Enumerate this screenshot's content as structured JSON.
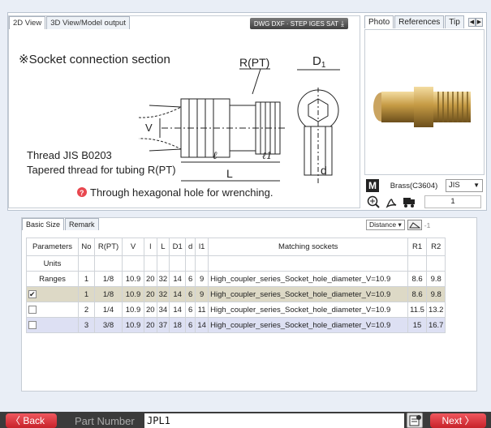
{
  "drawing": {
    "tabs": [
      "2D View",
      "3D View/Model output"
    ],
    "download_label": "DWG DXF · STEP IGES SAT",
    "section_title": "※Socket connection section",
    "label_rpt": "R(PT)",
    "label_d1": "D",
    "label_d1_sub": "1",
    "label_v": "V",
    "label_l": "ℓ",
    "label_l1": "ℓ1",
    "label_L": "L",
    "label_d": "d",
    "thread_line1": "Thread JIS B0203",
    "thread_line2": "Tapered thread for tubing R(PT)",
    "note": "Through hexagonal hole for wrenching."
  },
  "photo": {
    "tabs": [
      "Photo",
      "References",
      "Tip"
    ],
    "material_icon": "M",
    "material": "Brass(C3604)",
    "standard": "JIS",
    "quantity": "1"
  },
  "table": {
    "tabs": [
      "Basic Size",
      "Remark"
    ],
    "distance_label": "Distance",
    "distance_value": "-1",
    "headers": [
      "Parameters",
      "No",
      "R(PT)",
      "V",
      "l",
      "L",
      "D1",
      "d",
      "l1",
      "Matching sockets",
      "R1",
      "R2"
    ],
    "units_label": "Units",
    "ranges": [
      "Ranges",
      "1",
      "1/8",
      "10.9",
      "20",
      "32",
      "14",
      "6",
      "9",
      "High_coupler_series_Socket_hole_diameter_V=10.9",
      "8.6",
      "9.8"
    ],
    "rows": [
      {
        "checked": "✔",
        "cells": [
          "1",
          "1/8",
          "10.9",
          "20",
          "32",
          "14",
          "6",
          "9",
          "High_coupler_series_Socket_hole_diameter_V=10.9",
          "8.6",
          "9.8"
        ]
      },
      {
        "checked": "",
        "cells": [
          "2",
          "1/4",
          "10.9",
          "20",
          "34",
          "14",
          "6",
          "11",
          "High_coupler_series_Socket_hole_diameter_V=10.9",
          "11.5",
          "13.2"
        ]
      },
      {
        "checked": "",
        "cells": [
          "3",
          "3/8",
          "10.9",
          "20",
          "37",
          "18",
          "6",
          "14",
          "High_coupler_series_Socket_hole_diameter_V=10.9",
          "15",
          "16.7"
        ]
      }
    ]
  },
  "nav": {
    "back": "Back",
    "next": "Next",
    "part_number_label": "Part Number",
    "part_number": "JPL1"
  }
}
